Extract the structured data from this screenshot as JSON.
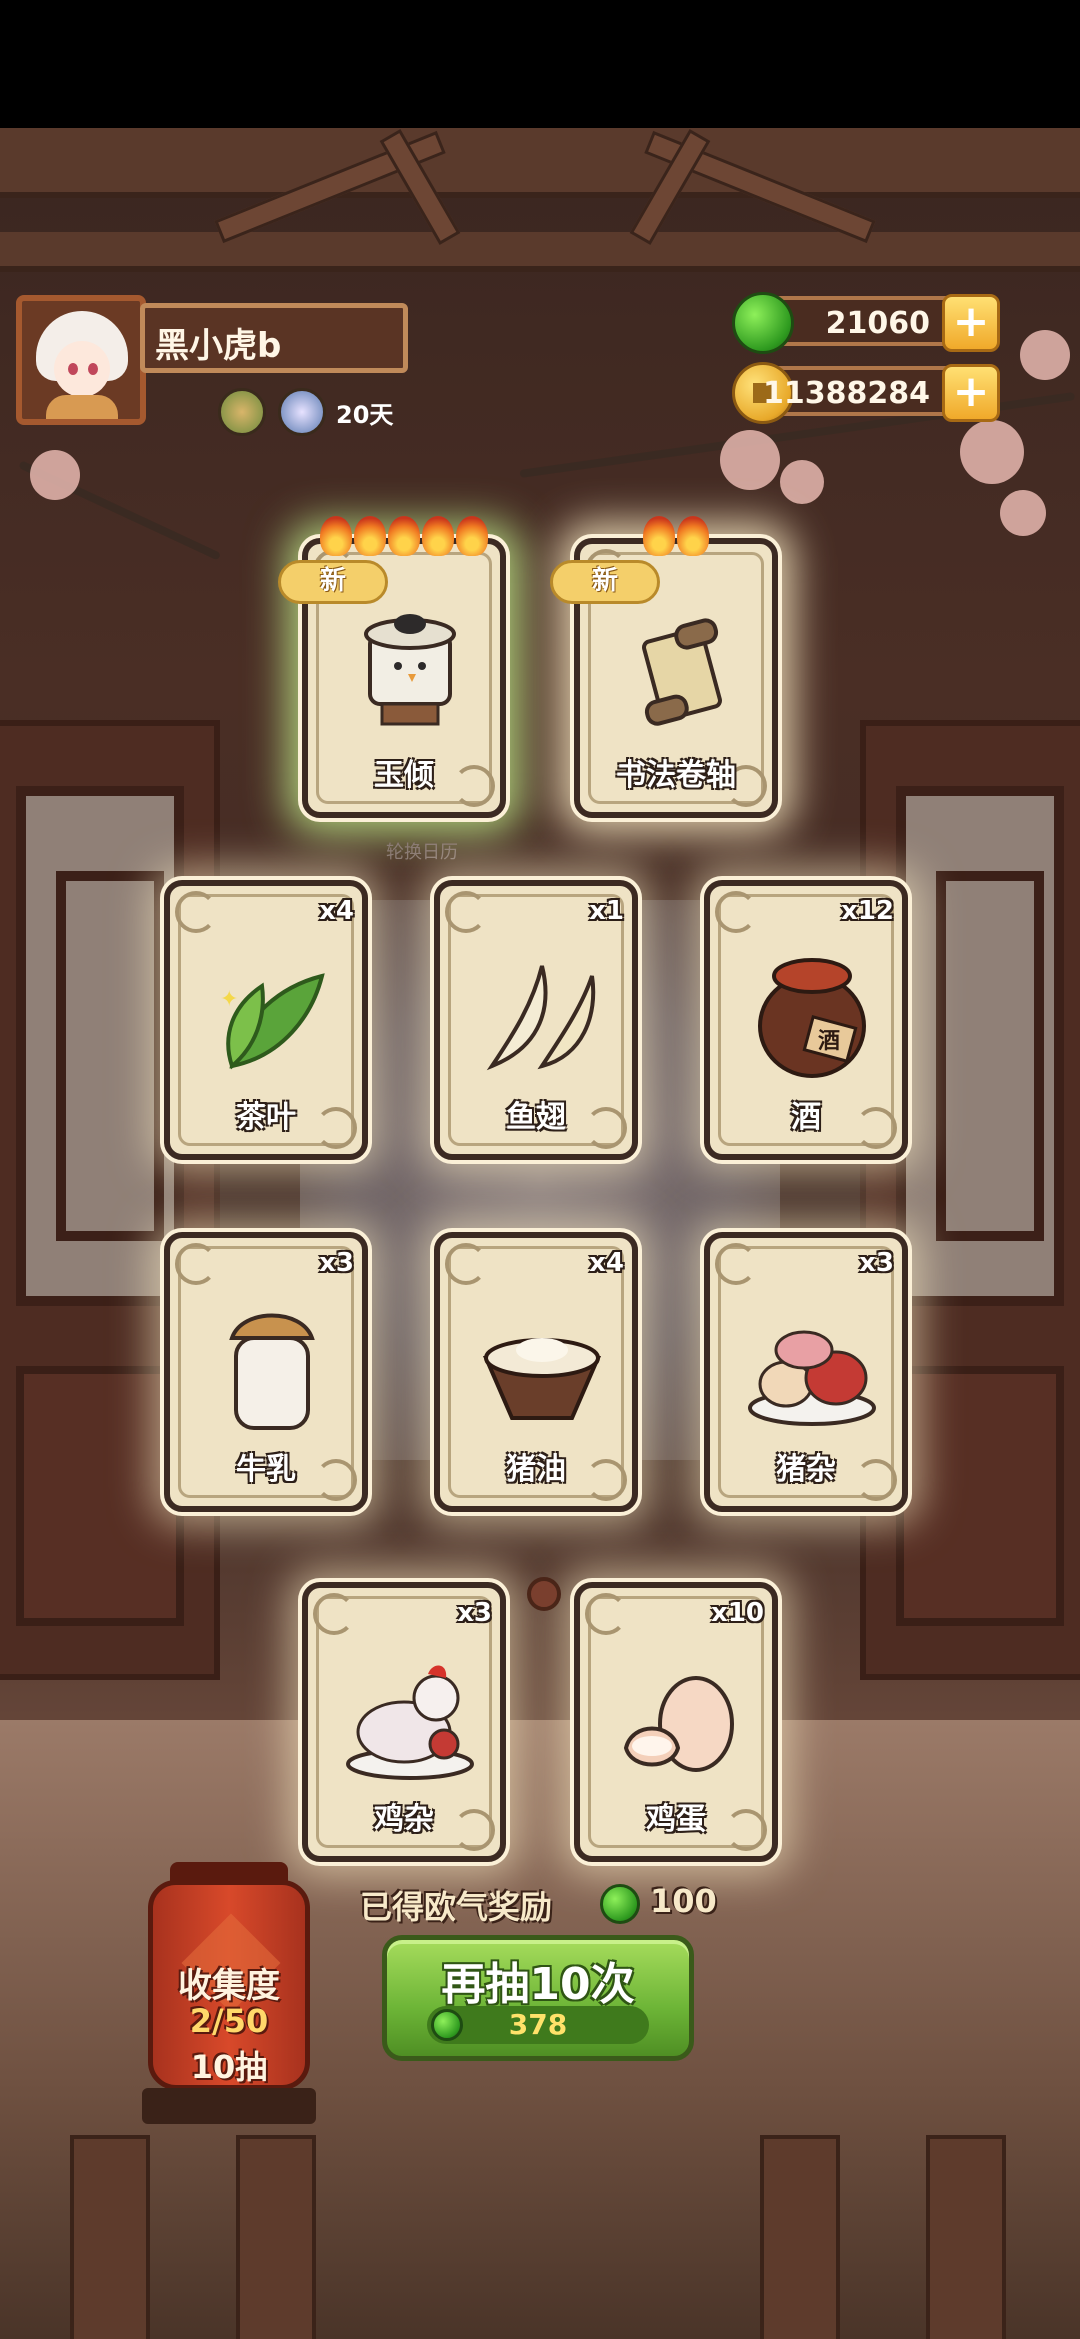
{
  "player": {
    "name": "黑小虎b",
    "days": "20天"
  },
  "currencies": [
    {
      "name": "jade",
      "value": "21060",
      "icon": "jade-icon"
    },
    {
      "name": "coin",
      "value": "11388284",
      "icon": "coin-icon"
    }
  ],
  "new_badge": "新",
  "calendar_label": "轮换日历",
  "featured_cards": [
    {
      "label": "玉倾",
      "flames": 5,
      "is_new": true,
      "icon": "jade-cup-icon"
    },
    {
      "label": "书法卷轴",
      "flames": 2,
      "is_new": true,
      "icon": "scroll-icon"
    }
  ],
  "cards": [
    {
      "label": "茶叶",
      "count": "x4",
      "icon": "tea-leaf-icon"
    },
    {
      "label": "鱼翅",
      "count": "x1",
      "icon": "shark-fin-icon"
    },
    {
      "label": "酒",
      "count": "x12",
      "icon": "wine-jar-icon",
      "jar_text": "酒"
    },
    {
      "label": "牛乳",
      "count": "x3",
      "icon": "milk-jar-icon"
    },
    {
      "label": "猪油",
      "count": "x4",
      "icon": "lard-bowl-icon"
    },
    {
      "label": "猪杂",
      "count": "x3",
      "icon": "pork-offal-icon"
    },
    {
      "label": "鸡杂",
      "count": "x3",
      "icon": "chicken-offal-icon"
    },
    {
      "label": "鸡蛋",
      "count": "x10",
      "icon": "egg-icon"
    }
  ],
  "reward": {
    "text": "已得欧气奖励",
    "value": "100"
  },
  "draw_button": {
    "label": "再抽10次",
    "cost": "378"
  },
  "collection": {
    "title": "收集度",
    "progress": "2/50",
    "draws": "10抽"
  },
  "colors": {
    "accent_green": "#6cb436",
    "card_bg": "#efe3c5",
    "lantern_red": "#d8492a"
  }
}
